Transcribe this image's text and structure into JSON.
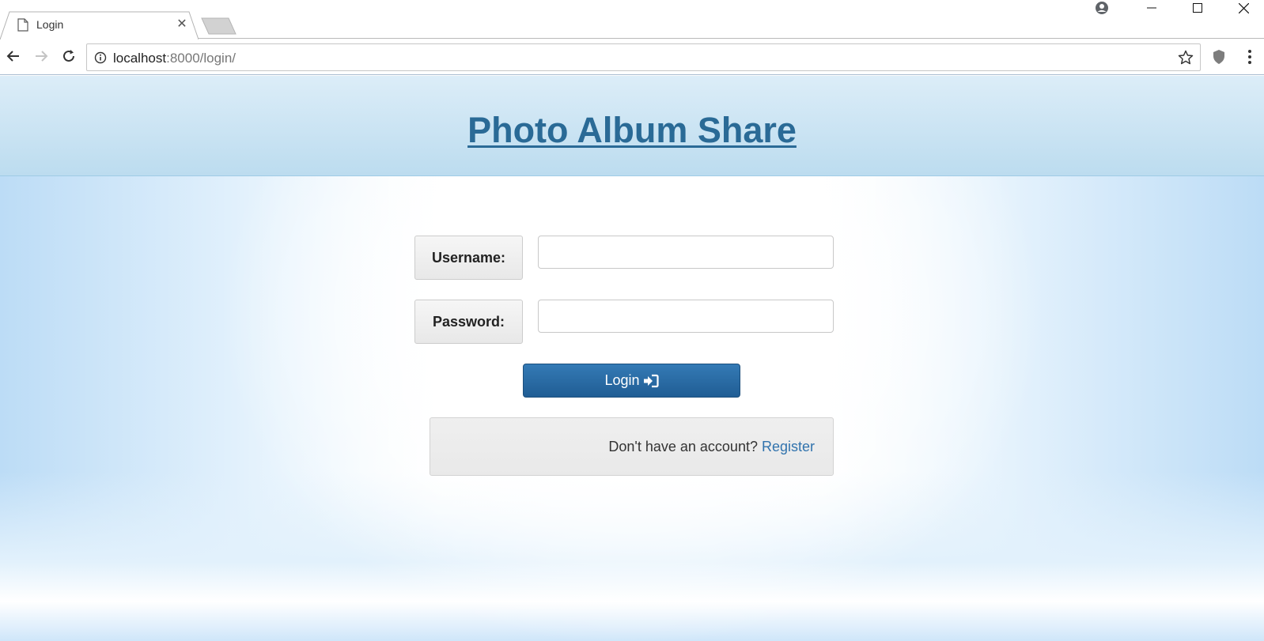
{
  "browser": {
    "tab_title": "Login",
    "url_host": "localhost",
    "url_rest": ":8000/login/"
  },
  "site": {
    "title": "Photo Album Share"
  },
  "form": {
    "username_label": "Username:",
    "username_value": "",
    "password_label": "Password:",
    "password_value": "",
    "login_button": "Login"
  },
  "register": {
    "prompt": "Don't have an account? ",
    "link": "Register"
  },
  "colors": {
    "header_gradient_top": "#dcedf8",
    "title": "#2a6a96",
    "button": "#2b6ca6",
    "link": "#3173ad"
  },
  "icons": {
    "login_button_icon": "sign-in-icon"
  }
}
